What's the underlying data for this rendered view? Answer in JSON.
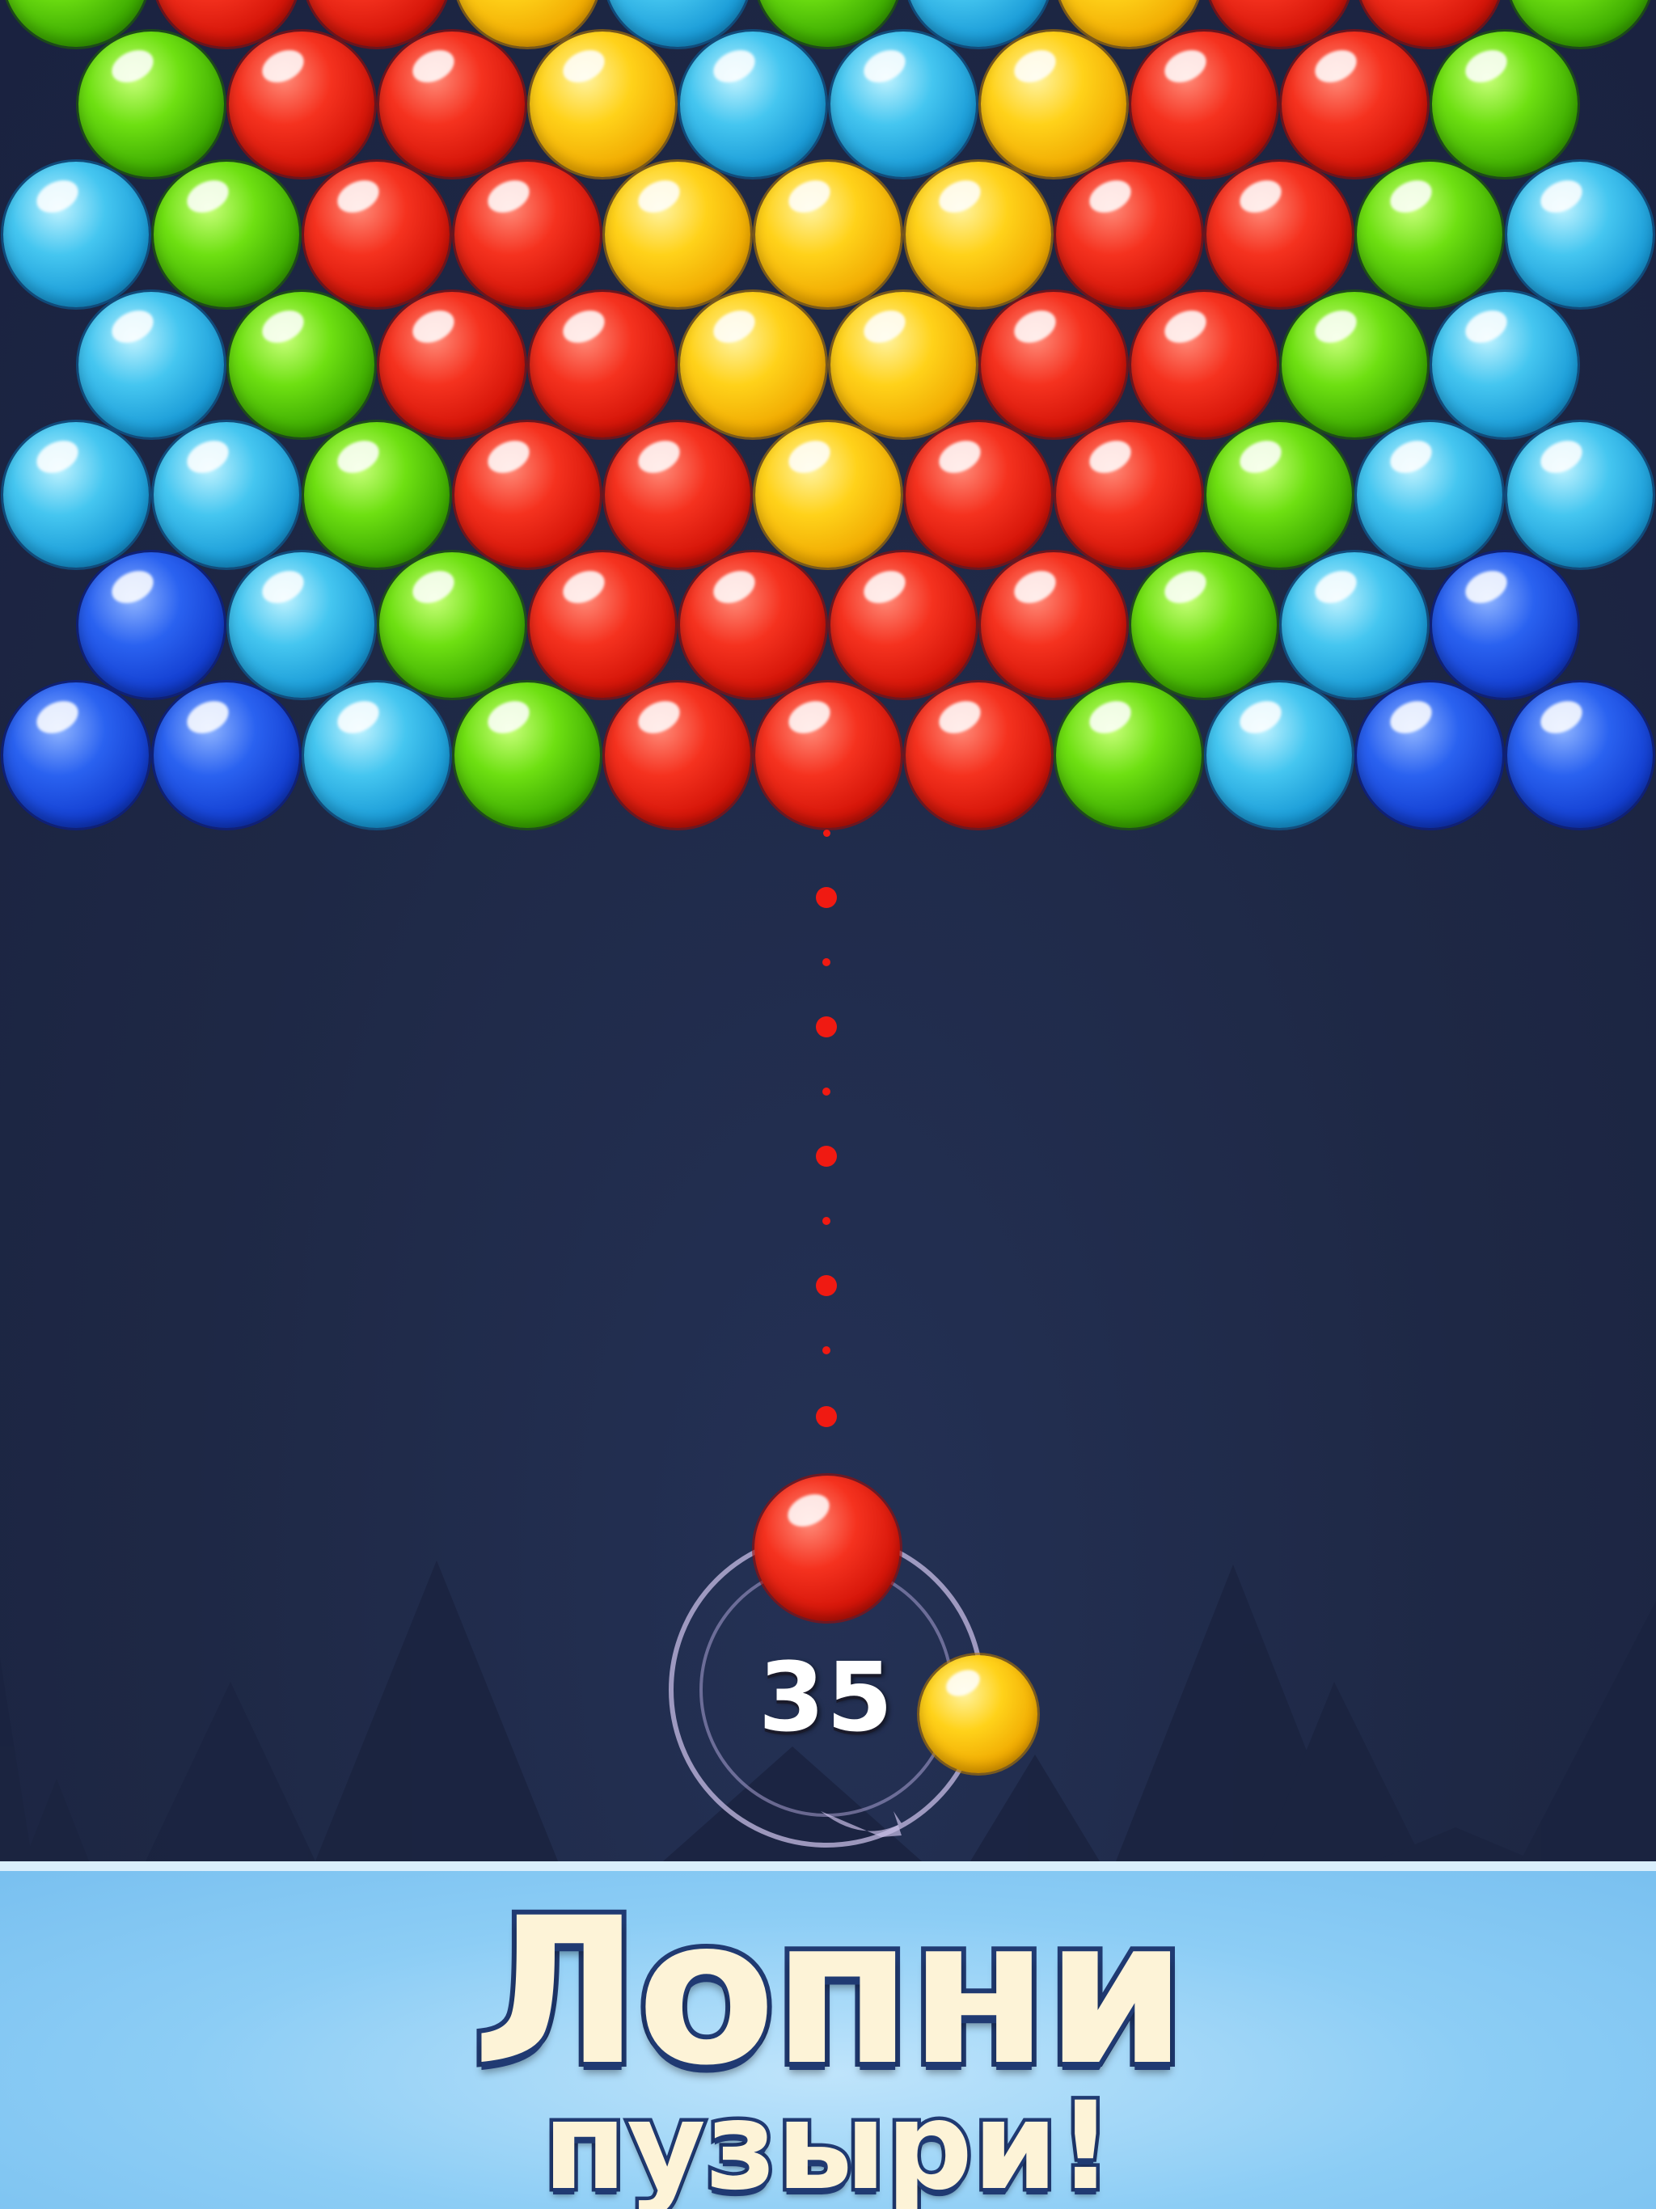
{
  "game": {
    "bubble_grid": [
      [
        "green",
        "red",
        "red",
        "yellow",
        "cyan",
        "green",
        "cyan",
        "yellow",
        "red",
        "red",
        "green"
      ],
      [
        "green",
        "red",
        "red",
        "yellow",
        "cyan",
        "cyan",
        "yellow",
        "red",
        "red",
        "green"
      ],
      [
        "cyan",
        "green",
        "red",
        "red",
        "yellow",
        "yellow",
        "yellow",
        "red",
        "red",
        "green",
        "cyan"
      ],
      [
        "cyan",
        "green",
        "red",
        "red",
        "yellow",
        "yellow",
        "red",
        "red",
        "green",
        "cyan"
      ],
      [
        "cyan",
        "cyan",
        "green",
        "red",
        "red",
        "yellow",
        "red",
        "red",
        "green",
        "cyan",
        "cyan"
      ],
      [
        "blue",
        "cyan",
        "green",
        "red",
        "red",
        "red",
        "red",
        "green",
        "cyan",
        "blue"
      ],
      [
        "blue",
        "blue",
        "cyan",
        "green",
        "red",
        "red",
        "red",
        "green",
        "cyan",
        "blue",
        "blue"
      ]
    ],
    "aim_color": "red",
    "shooter_bubble": "red",
    "next_bubble": "yellow",
    "moves_left": "35"
  },
  "colors": {
    "background": "#1d2744",
    "aim_dots": "#f01a12",
    "banner": "#8ccdf5",
    "title_fill": "#fdf3d7",
    "title_outline": "#203a72"
  },
  "banner": {
    "line1": "Лопни",
    "line2": "пузыри!"
  }
}
